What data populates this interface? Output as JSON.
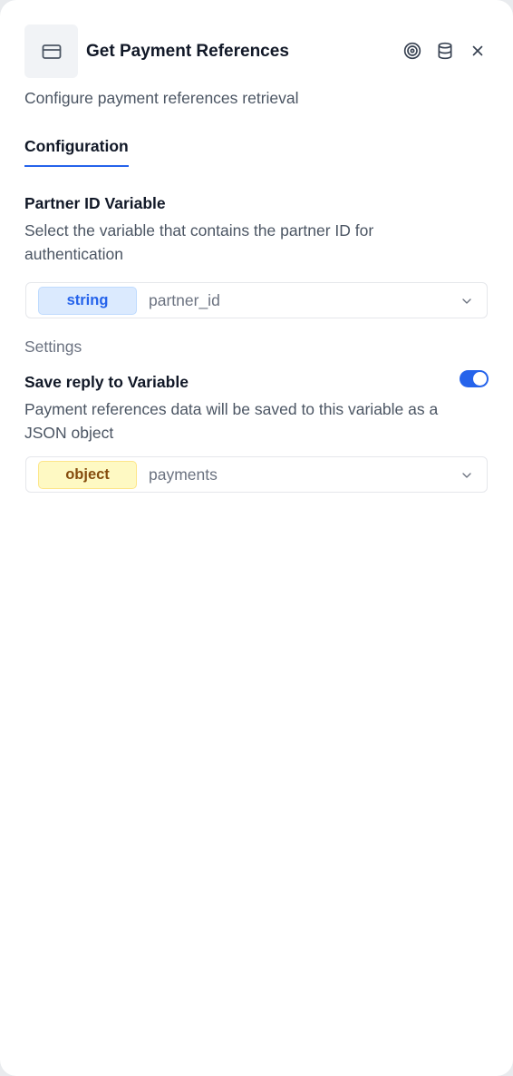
{
  "header": {
    "title": "Get Payment References",
    "subtitle": "Configure payment references retrieval",
    "node_icon": "credit-card-icon",
    "actions": [
      "target-icon",
      "database-icon",
      "close-icon"
    ]
  },
  "tabs": [
    {
      "label": "Configuration",
      "active": true
    }
  ],
  "partner_section": {
    "label": "Partner ID Variable",
    "description": "Select the variable that contains the partner ID for authentication",
    "select": {
      "type": "string",
      "value": "partner_id"
    }
  },
  "settings": {
    "label": "Settings",
    "save_reply": {
      "label": "Save reply to Variable",
      "enabled": true,
      "description": "Payment references data will be saved to this variable as a JSON object",
      "select": {
        "type": "object",
        "value": "payments"
      }
    }
  },
  "colors": {
    "accent": "#2563eb",
    "string_badge_bg": "#dbeafe",
    "object_badge_bg": "#fef9c3"
  }
}
